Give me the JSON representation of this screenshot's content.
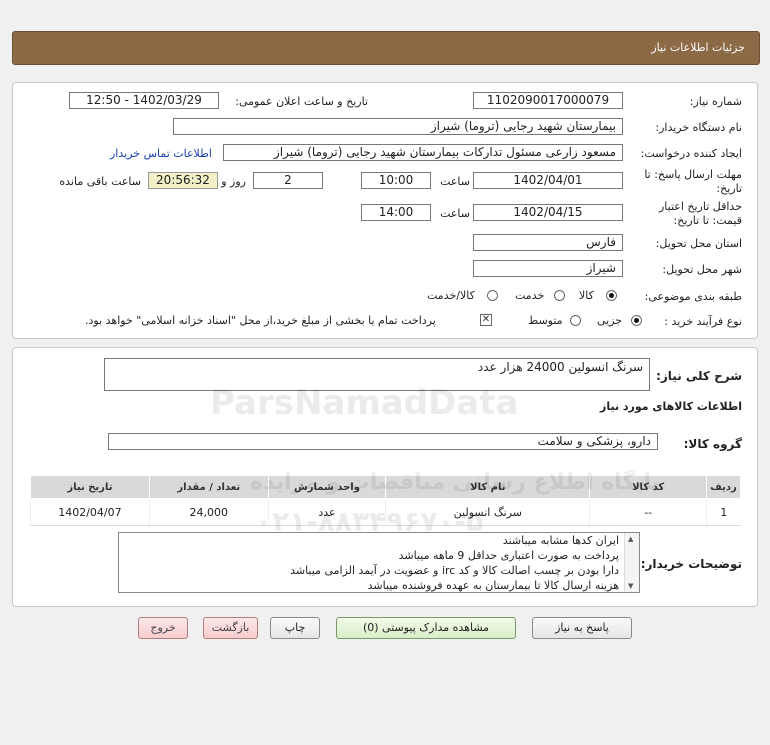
{
  "header": {
    "title": "جزئیات اطلاعات نیاز"
  },
  "fields": {
    "need_number_label": "شماره نیاز:",
    "need_number": "1102090017000079",
    "announce_label": "تاریخ و ساعت اعلان عمومی:",
    "announce_value": "1402/03/29 - 12:50",
    "buyer_org_label": "نام دستگاه خریدار:",
    "buyer_org": "بیمارستان شهید رجایی (تروما) شیراز",
    "requester_label": "ایجاد کننده درخواست:",
    "requester": "مسعود زارعی مسئول تدارکات بیمارستان شهید رجایی (تروما) شیراز",
    "contact_link": "اطلاعات تماس خریدار",
    "deadline_label_1": "مهلت ارسال پاسخ: تا",
    "deadline_label_2": "تاریخ:",
    "deadline_date": "1402/04/01",
    "time_label": "ساعت",
    "deadline_time": "10:00",
    "days_value": "2",
    "days_label": "روز و",
    "remaining_value": "20:56:32",
    "remaining_label": "ساعت باقی مانده",
    "validity_label_1": "حداقل تاریخ اعتبار",
    "validity_label_2": "قیمت: تا تاریخ:",
    "validity_date": "1402/04/15",
    "validity_time_label": "ساعت",
    "validity_time": "14:00",
    "province_label": "استان محل تحویل:",
    "province": "فارس",
    "city_label": "شهر محل تحویل:",
    "city": "شیراز",
    "category_label": "طبقه بندی موضوعی:",
    "category_options": [
      "کالا",
      "خدمت",
      "کالا/خدمت"
    ],
    "category_selected": "کالا",
    "process_label": "نوع فرآیند خرید :",
    "process_options": [
      "جزیی",
      "متوسط"
    ],
    "process_selected": "جزیی",
    "payment_note": "پرداخت تمام یا بخشی از مبلغ خرید،از محل \"اسناد خزانه اسلامی\" خواهد بود."
  },
  "summary": {
    "label": "شرح کلی نیاز:",
    "value": "سرنگ انسولین 24000 هزار عدد",
    "goods_info_title": "اطلاعات کالاهای مورد نیاز",
    "group_label": "گروه کالا:",
    "group_value": "دارو، پزشکی و سلامت"
  },
  "table": {
    "headers": [
      "ردیف",
      "کد کالا",
      "نام کالا",
      "واحد شمارش",
      "تعداد / مقدار",
      "تاریخ نیاز"
    ],
    "rows": [
      [
        "1",
        "--",
        "سرنگ انسولین",
        "عدد",
        "24,000",
        "1402/04/07"
      ]
    ]
  },
  "notes": {
    "label": "توضیحات خریدار:",
    "lines": [
      "ایران کدها مشابه  میباشند",
      "پرداخت به صورت اعتباری حداقل 9 ماهه میباشد",
      "دارا بودن بر چسب اصالت کالا و کد irc و عضویت در آیمد الزامی میباشد",
      "هزینه ارسال کالا تا بیمارستان به عهده فروشنده میباشد"
    ]
  },
  "buttons": {
    "reply": "پاسخ به نیاز",
    "attachments": "مشاهده مدارک پیوستی (0)",
    "print": "چاپ",
    "back": "بازگشت",
    "exit": "خروج"
  },
  "watermark": {
    "brand": "ParsNamadData",
    "line1": "پایگاه اطلاع رسانی مناقصات و مزایده",
    "phone": "۰۲۱-۸۸۳۴۹۶۷۰-۵"
  },
  "colors": {
    "header_bg": "#8d6a46",
    "link": "#1a3fb0",
    "remaining_bg": "#f2f0c6"
  }
}
